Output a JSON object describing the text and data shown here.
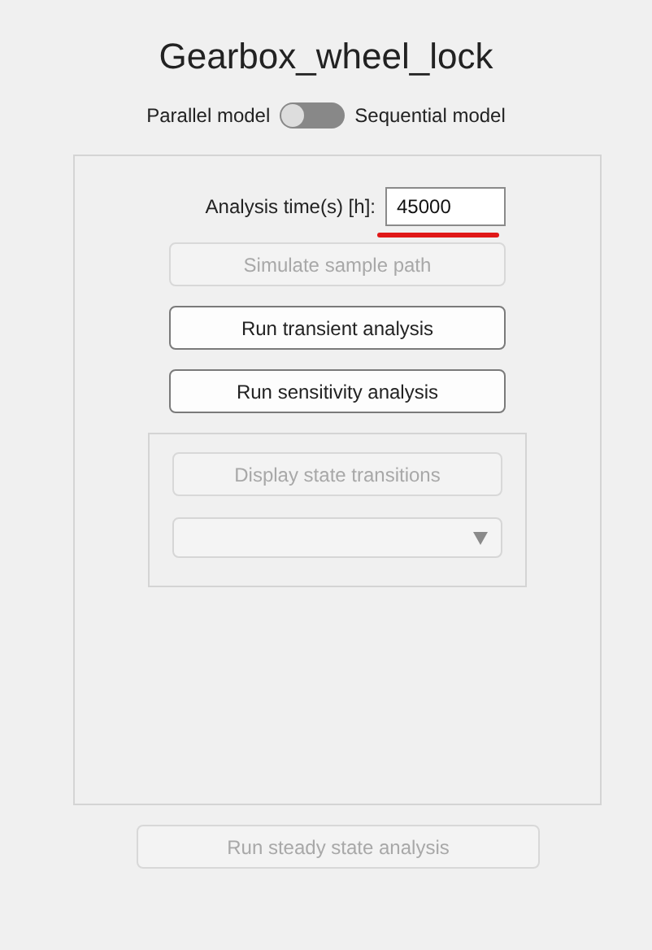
{
  "title": "Gearbox_wheel_lock",
  "model_switch": {
    "left_label": "Parallel model",
    "right_label": "Sequential model",
    "on": false
  },
  "analysis_time": {
    "label": "Analysis time(s) [h]:",
    "value": "45000",
    "highlighted": true
  },
  "buttons": [
    {
      "label": "Simulate sample path",
      "disabled": true
    },
    {
      "label": "Run transient analysis",
      "disabled": false
    },
    {
      "label": "Run sensitivity analysis",
      "disabled": false
    }
  ],
  "transitions_panel": {
    "button": {
      "label": "Display state transitions",
      "disabled": true
    },
    "dropdown": {
      "disabled": true
    }
  },
  "steady_button": {
    "label": "Run steady state analysis",
    "disabled": true
  }
}
